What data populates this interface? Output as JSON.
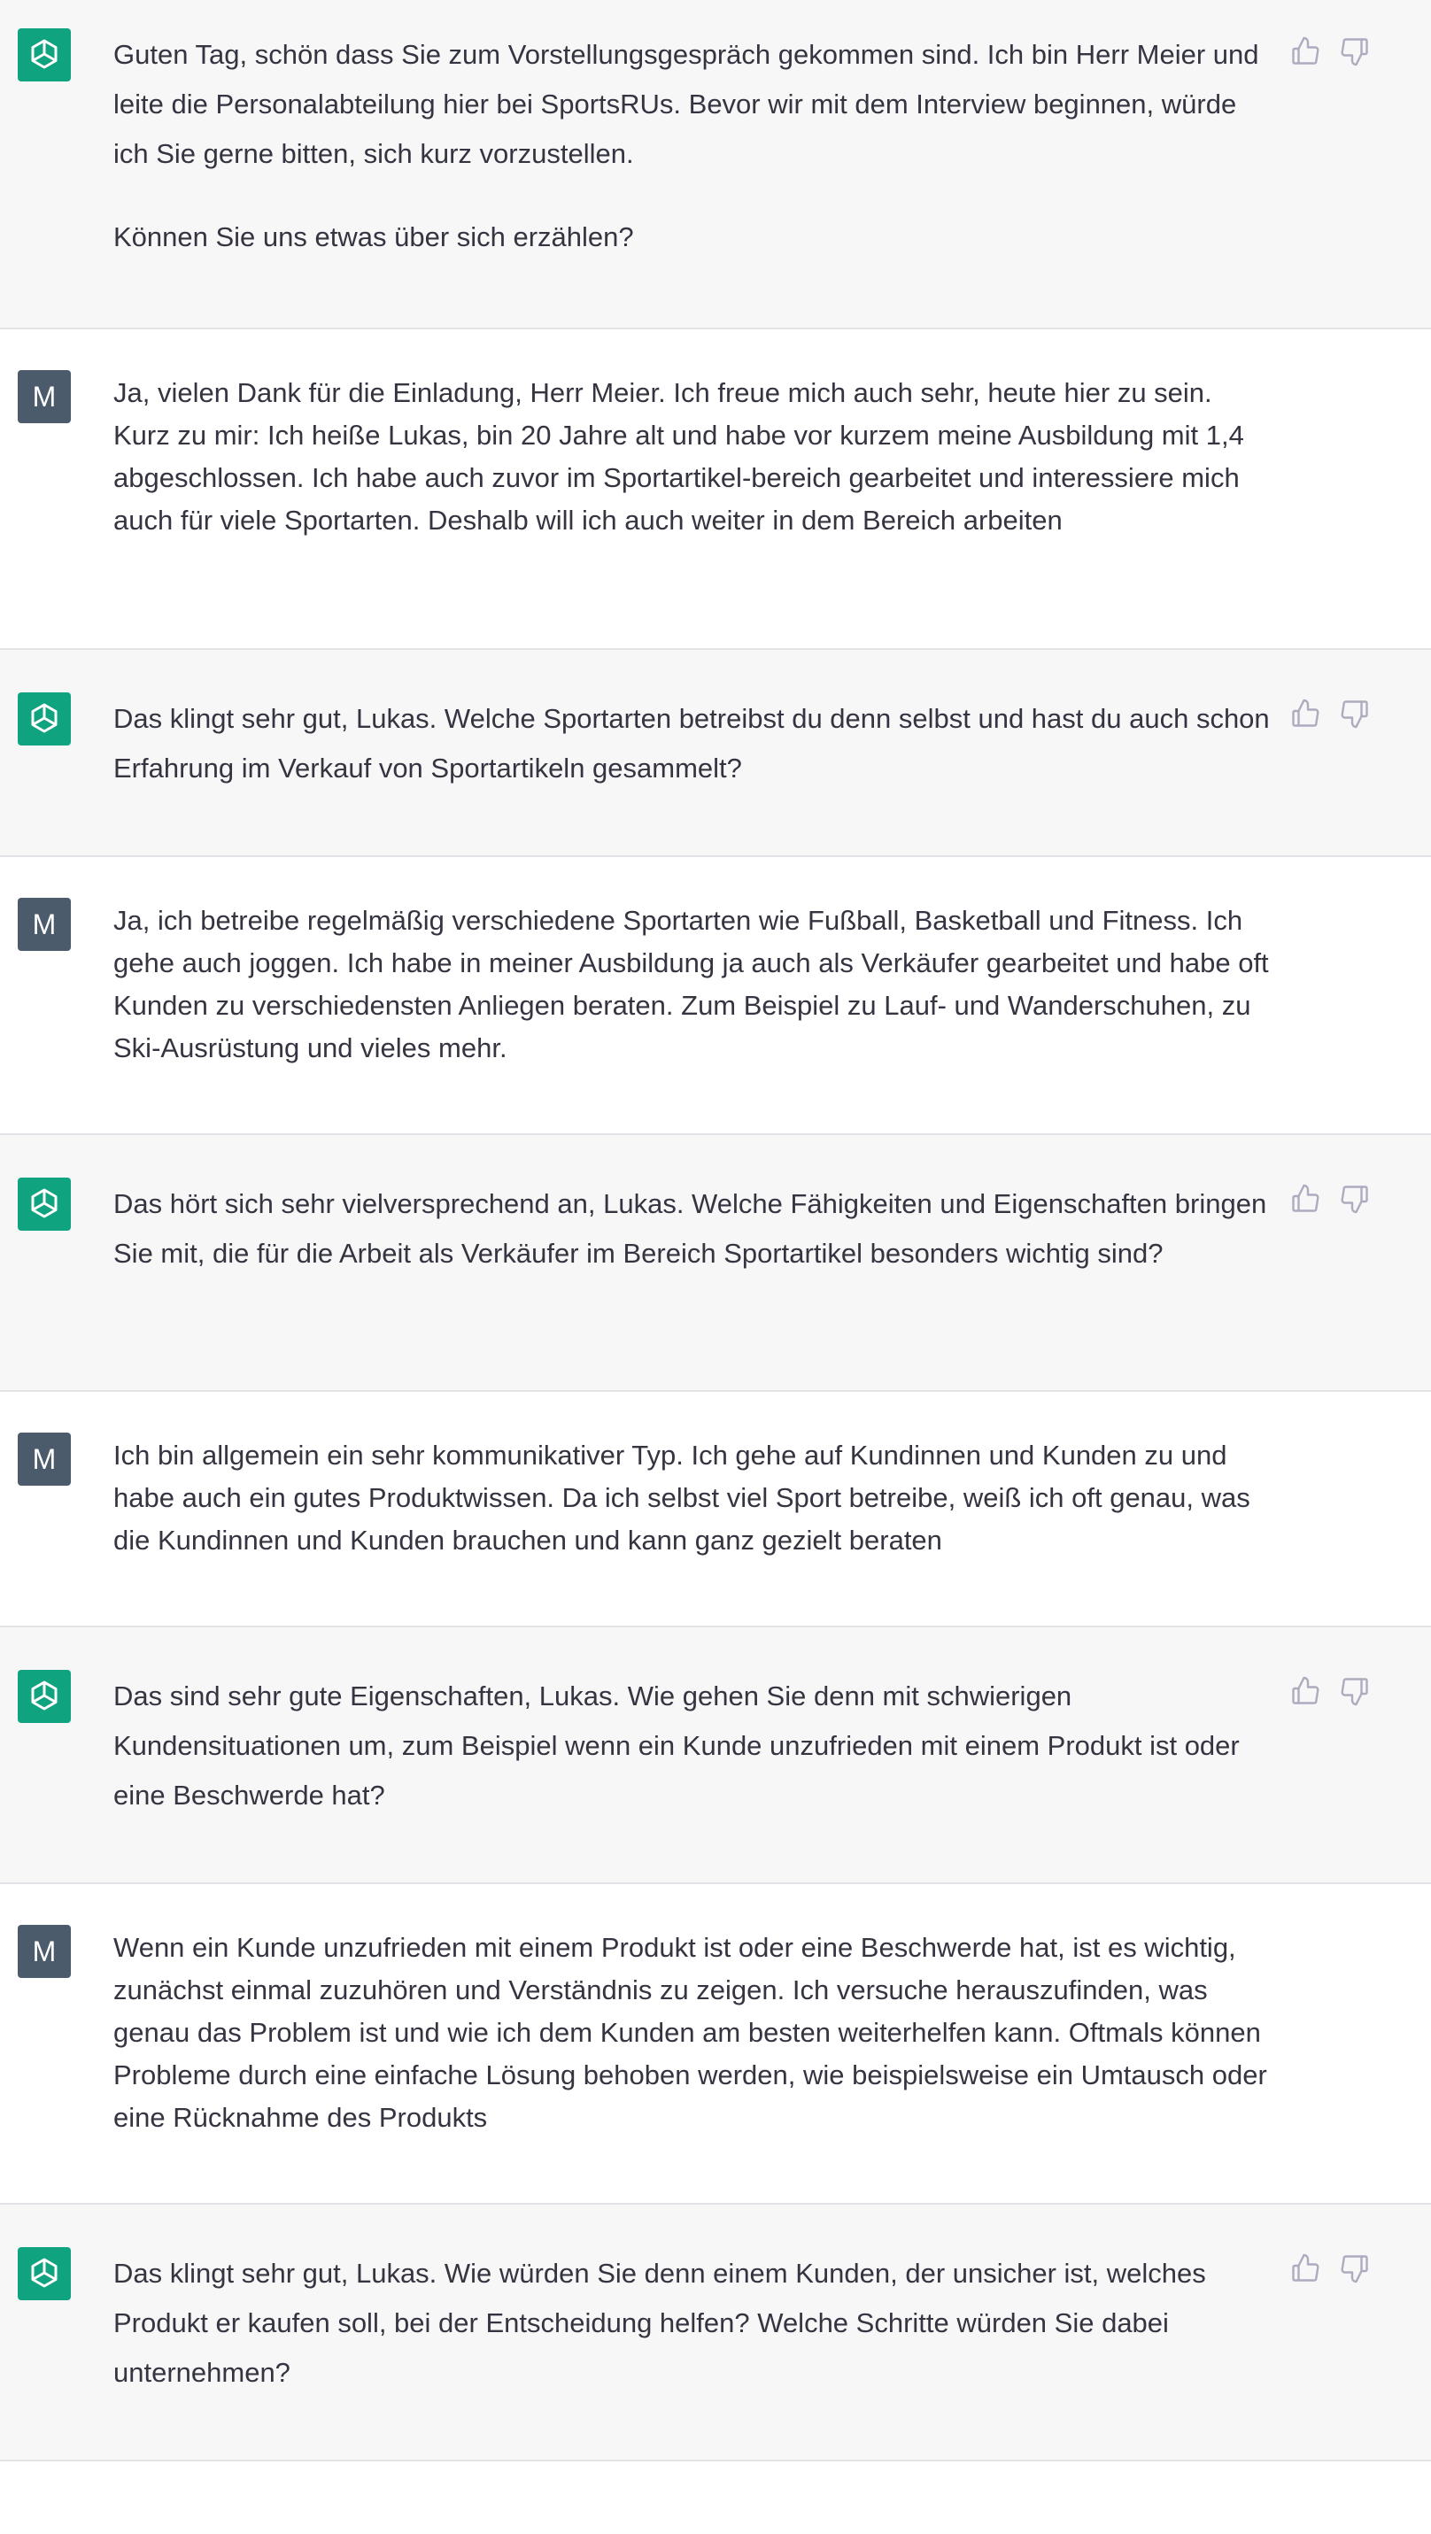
{
  "conversation": {
    "messages": [
      {
        "role": "assistant",
        "paragraphs": [
          "Guten Tag, schön dass Sie zum Vorstellungsgespräch gekommen sind. Ich bin Herr Meier und leite die Personalabteilung hier bei SportsRUs. Bevor wir mit dem Interview beginnen, würde ich Sie gerne bitten, sich kurz vorzustellen.",
          "Können Sie uns etwas über sich erzählen?"
        ]
      },
      {
        "role": "user",
        "avatar_letter": "M",
        "paragraphs": [
          "Ja, vielen Dank für die Einladung, Herr Meier. Ich freue mich auch sehr, heute hier zu sein. Kurz zu mir: Ich heiße Lukas, bin 20 Jahre alt und habe vor kurzem meine Ausbildung mit 1,4 abgeschlossen. Ich habe auch zuvor im Sportartikel-bereich gearbeitet und interessiere mich auch für viele Sportarten. Deshalb will ich auch weiter in dem Bereich arbeiten"
        ]
      },
      {
        "role": "assistant",
        "paragraphs": [
          "Das klingt sehr gut, Lukas. Welche Sportarten betreibst du denn selbst und hast du auch schon Erfahrung im Verkauf von Sportartikeln gesammelt?"
        ]
      },
      {
        "role": "user",
        "avatar_letter": "M",
        "paragraphs": [
          "Ja, ich betreibe regelmäßig verschiedene Sportarten wie Fußball, Basketball und Fitness. Ich gehe auch joggen. Ich habe in meiner Ausbildung  ja auch als Verkäufer gearbeitet und habe oft Kunden zu verschiedensten Anliegen beraten. Zum Beispiel zu Lauf- und Wanderschuhen, zu Ski-Ausrüstung und vieles mehr."
        ]
      },
      {
        "role": "assistant",
        "paragraphs": [
          "Das hört sich sehr vielversprechend an, Lukas. Welche Fähigkeiten und Eigenschaften bringen Sie mit, die für die Arbeit als Verkäufer im Bereich Sportartikel besonders wichtig sind?"
        ]
      },
      {
        "role": "user",
        "avatar_letter": "M",
        "paragraphs": [
          "Ich bin allgemein ein sehr kommunikativer Typ. Ich gehe auf Kundinnen und Kunden zu und habe auch ein gutes Produktwissen. Da ich selbst viel Sport betreibe, weiß ich oft genau, was die Kundinnen und Kunden brauchen und kann ganz gezielt beraten"
        ]
      },
      {
        "role": "assistant",
        "paragraphs": [
          "Das sind sehr gute Eigenschaften, Lukas. Wie gehen Sie denn mit schwierigen Kundensituationen um, zum Beispiel wenn ein Kunde unzufrieden mit einem Produkt ist oder eine Beschwerde hat?"
        ]
      },
      {
        "role": "user",
        "avatar_letter": "M",
        "paragraphs": [
          "Wenn ein Kunde unzufrieden mit einem Produkt ist oder eine Beschwerde hat, ist es wichtig, zunächst einmal zuzuhören und Verständnis zu zeigen. Ich versuche herauszufinden, was genau das Problem ist und wie ich dem Kunden am besten weiterhelfen kann. Oftmals können Probleme durch eine einfache Lösung behoben werden, wie beispielsweise ein Umtausch oder eine Rücknahme des Produkts"
        ]
      },
      {
        "role": "assistant",
        "paragraphs": [
          "Das klingt sehr gut, Lukas. Wie würden Sie denn einem Kunden, der unsicher ist, welches Produkt er kaufen soll, bei der Entscheidung helfen? Welche Schritte würden Sie dabei unternehmen?"
        ]
      }
    ]
  },
  "colors": {
    "assistant_bg": "#f7f7f8",
    "user_bg": "#ffffff",
    "bot_avatar": "#10a37f",
    "user_avatar": "#4b5b6b",
    "text": "#343541",
    "icon": "#acacbe"
  },
  "icons": {
    "assistant_avatar": "openai-logo-icon",
    "feedback_up": "thumbs-up-icon",
    "feedback_down": "thumbs-down-icon"
  }
}
